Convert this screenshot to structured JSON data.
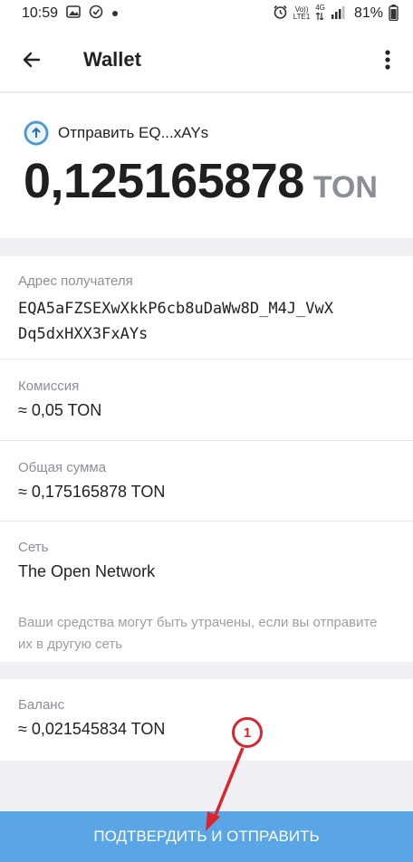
{
  "status_bar": {
    "time": "10:59",
    "network_top": "Vo))",
    "network_bottom": "LTE1",
    "signal_type": "4G",
    "battery": "81%"
  },
  "app_bar": {
    "title": "Wallet"
  },
  "header": {
    "send_label": "Отправить EQ...xAYs",
    "amount": "0,125165878",
    "currency": "TON"
  },
  "details": {
    "recipient_label": "Адрес получателя",
    "recipient_line1": "EQA5aFZSEXwXkkP6cb8uDaWw8D_M4J_VwX",
    "recipient_line2": "Dq5dxHXX3FxAYs",
    "fee_label": "Комиссия",
    "fee_value": "≈ 0,05 TON",
    "total_label": "Общая сумма",
    "total_value": "≈ 0,175165878 TON",
    "network_label": "Сеть",
    "network_value": "The Open Network",
    "warning": "Ваши средства могут быть утрачены, если вы отправите их в другую сеть"
  },
  "balance": {
    "label": "Баланс",
    "value": "≈ 0,021545834 TON"
  },
  "confirm_button": "ПОДТВЕРДИТЬ И ОТПРАВИТЬ",
  "annotation": {
    "number": "1",
    "color": "#d9262c"
  },
  "colors": {
    "accent": "#5aa5e6",
    "send_icon": "#4a9ad9",
    "muted_text": "#8a8f96"
  }
}
